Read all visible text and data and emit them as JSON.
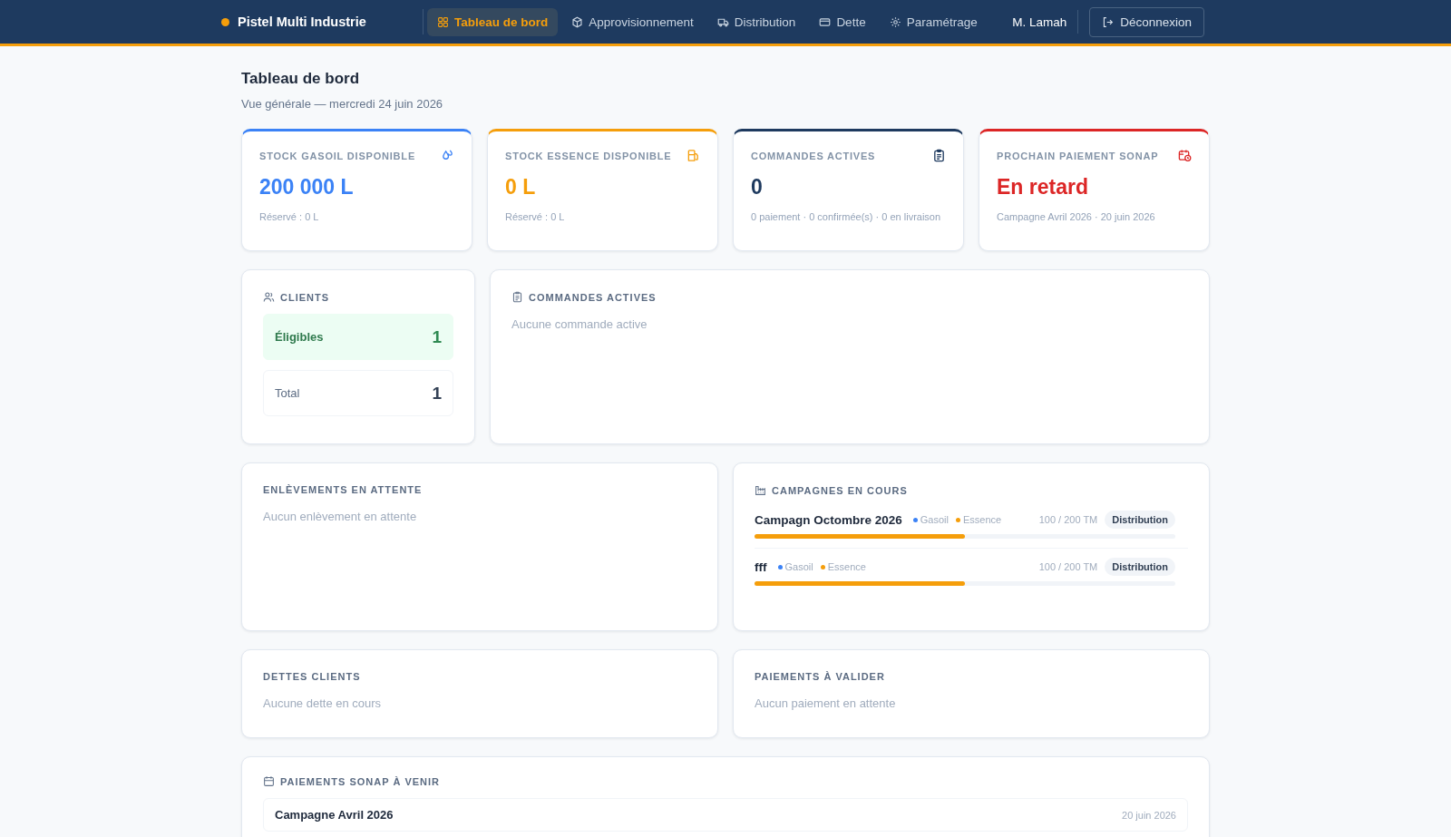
{
  "brand": {
    "name": "Pistel Multi Industrie"
  },
  "nav": [
    {
      "label": "Tableau de bord",
      "kind": "grid",
      "selected": true
    },
    {
      "label": "Approvisionnement",
      "kind": "box",
      "selected": false
    },
    {
      "label": "Distribution",
      "kind": "truck",
      "selected": false
    },
    {
      "label": "Dette",
      "kind": "card",
      "selected": false
    },
    {
      "label": "Paramétrage",
      "kind": "gear",
      "selected": false
    }
  ],
  "user": "M. Lamah",
  "logout": "Déconnexion",
  "page": {
    "title": "Tableau de bord",
    "subtitle": "Vue générale — mercredi 24 juin 2026"
  },
  "stats": [
    {
      "label": "STOCK GASOIL DISPONIBLE",
      "kind": "drop",
      "color": "#3b82f6",
      "value": "200 000 L",
      "sub": "Réservé : 0 L"
    },
    {
      "label": "STOCK ESSENCE DISPONIBLE",
      "kind": "pump",
      "color": "#f59e0b",
      "value": "0 L",
      "sub": "Réservé : 0 L"
    },
    {
      "label": "COMMANDES ACTIVES",
      "kind": "clipboard",
      "color": "#1e3a5f",
      "value": "0",
      "sub": "0 paiement · 0 confirmée(s) · 0 en livraison"
    },
    {
      "label": "PROCHAIN PAIEMENT SONAP",
      "kind": "calclock",
      "color": "#dc2626",
      "value": "En retard",
      "sub": "Campagne Avril 2026 · 20 juin 2026"
    }
  ],
  "clients": {
    "title": "CLIENTS",
    "rows": [
      {
        "label": "Éligibles",
        "value": "1",
        "kind": "highlight"
      },
      {
        "label": "Total",
        "value": "1",
        "kind": "plain"
      }
    ]
  },
  "orders": {
    "title": "COMMANDES ACTIVES",
    "empty": "Aucune commande active"
  },
  "pickups": {
    "title": "ENLÈVEMENTS EN ATTENTE",
    "empty": "Aucun enlèvement en attente"
  },
  "campaigns": {
    "title": "CAMPAGNES EN COURS",
    "items": [
      {
        "name": "Campagn Octombre 2026",
        "fuels": [
          {
            "label": "Gasoil",
            "color": "#3b82f6"
          },
          {
            "label": "Essence",
            "color": "#f59e0b"
          }
        ],
        "reading": "100 / 200 TM",
        "status": "Distribution",
        "level": 0.5
      },
      {
        "name": "fff",
        "fuels": [
          {
            "label": "Gasoil",
            "color": "#3b82f6"
          },
          {
            "label": "Essence",
            "color": "#f59e0b"
          }
        ],
        "reading": "100 / 200 TM",
        "status": "Distribution",
        "level": 0.5
      }
    ]
  },
  "debts": {
    "title": "DETTES CLIENTS",
    "empty": "Aucune dette en cours"
  },
  "payments": {
    "title": "PAIEMENTS À VALIDER",
    "empty": "Aucun paiement en attente"
  },
  "sonap": {
    "title": "PAIEMENTS SONAP À VENIR",
    "items": [
      {
        "name": "Campagne Avril 2026",
        "date": "20 juin 2026"
      }
    ]
  }
}
